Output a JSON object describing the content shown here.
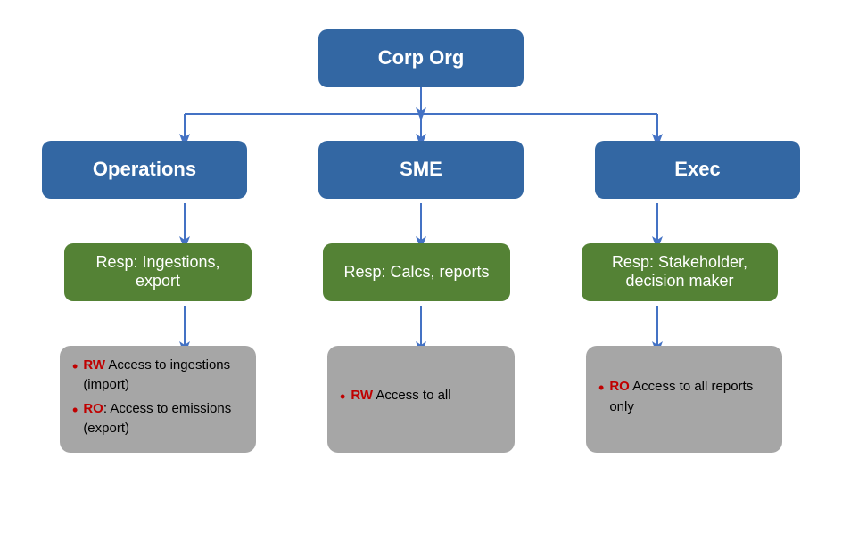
{
  "root": {
    "label": "Corp Org"
  },
  "columns": [
    {
      "id": "operations",
      "top_label": "Operations",
      "resp_label": "Resp: Ingestions, export",
      "access_bullets": [
        {
          "prefix": "RW",
          "text": " Access to ingestions (import)"
        },
        {
          "prefix": "RO",
          "text": ": Access to emissions (export)"
        }
      ]
    },
    {
      "id": "sme",
      "top_label": "SME",
      "resp_label": "Resp: Calcs, reports",
      "access_bullets": [
        {
          "prefix": "RW",
          "text": " Access to all"
        }
      ]
    },
    {
      "id": "exec",
      "top_label": "Exec",
      "resp_label": "Resp: Stakeholder, decision maker",
      "access_bullets": [
        {
          "prefix": "RO",
          "text": " Access to all reports only"
        }
      ]
    }
  ],
  "arrow_color": "#4472c4"
}
